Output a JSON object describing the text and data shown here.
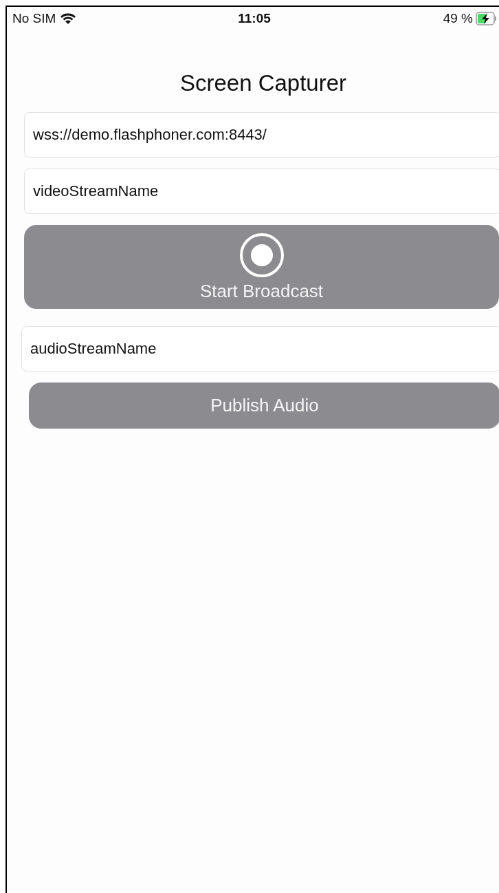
{
  "status_bar": {
    "carrier": "No SIM",
    "time": "11:05",
    "battery": "49 %",
    "charging": true
  },
  "title": "Screen Capturer",
  "server_field": {
    "value": "wss://demo.flashphoner.com:8443/"
  },
  "video_stream_field": {
    "value": "videoStreamName"
  },
  "broadcast_button": {
    "label": "Start Broadcast"
  },
  "audio_stream_field": {
    "value": "audioStreamName"
  },
  "publish_audio_button": {
    "label": "Publish Audio"
  }
}
